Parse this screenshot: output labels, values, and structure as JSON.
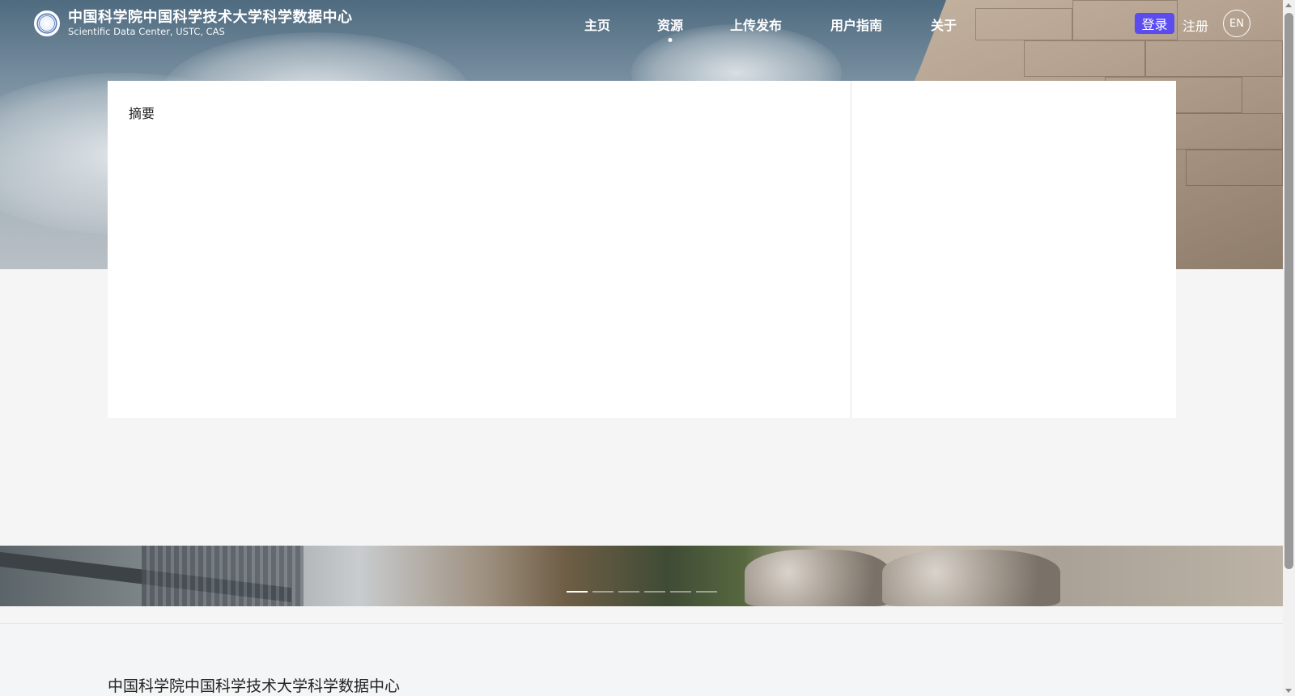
{
  "header": {
    "org_name_cn": "中国科学院中国科学技术大学科学数据中心",
    "org_name_en": "Scientific Data Center, USTC, CAS",
    "nav": [
      {
        "label": "主页"
      },
      {
        "label": "资源",
        "active": true
      },
      {
        "label": "上传发布"
      },
      {
        "label": "用户指南"
      },
      {
        "label": "关于"
      }
    ],
    "login_label": "登录",
    "register_label": "注册",
    "language_label": "EN"
  },
  "main": {
    "abstract_title": "摘要"
  },
  "carousel": {
    "slide_count": 6,
    "active_index": 0
  },
  "footer": {
    "title": "中国科学院中国科学技术大学科学数据中心"
  },
  "colors": {
    "accent": "#5b4cf0",
    "page_bg": "#f5f5f5",
    "card_bg": "#ffffff"
  }
}
